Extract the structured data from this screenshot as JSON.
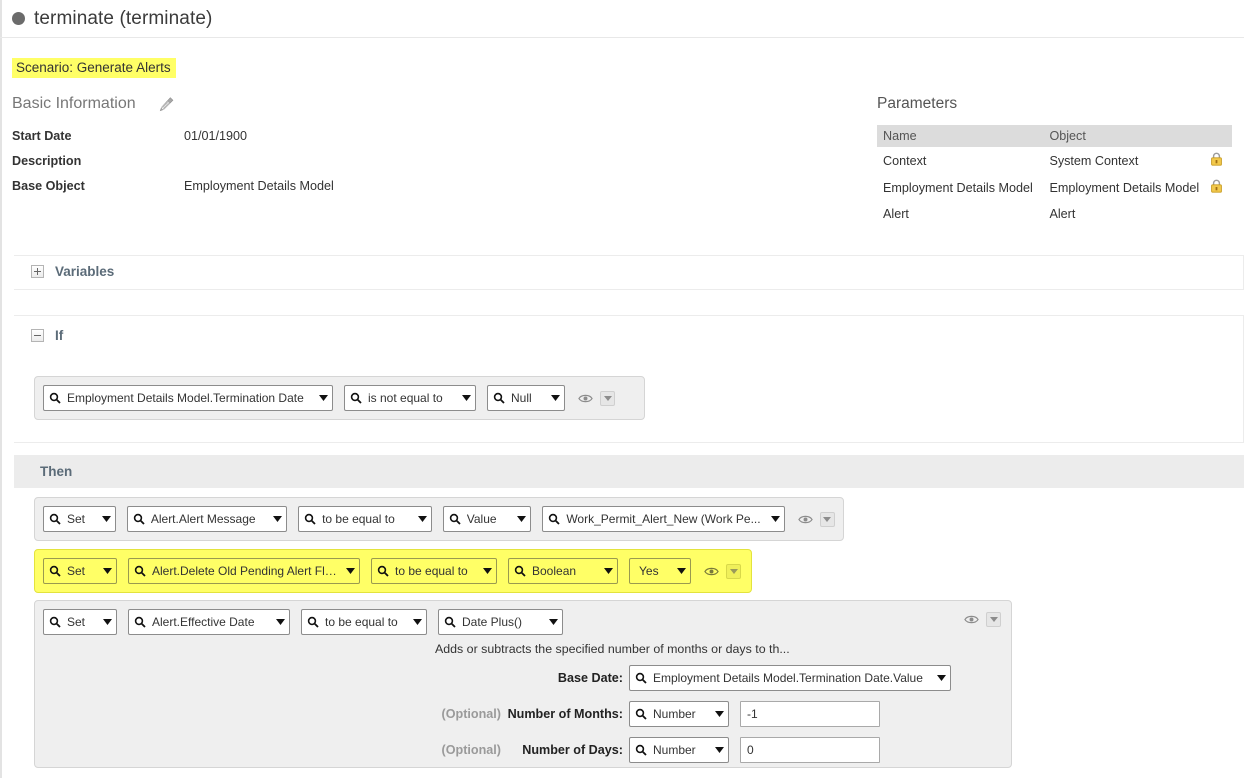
{
  "title": {
    "text": "terminate (terminate)",
    "status_icon": "circle-icon"
  },
  "scenario": {
    "label": "Scenario: Generate Alerts",
    "highlight_color": "#ffff66"
  },
  "basic_information": {
    "heading": "Basic Information",
    "edit_icon": "pencil-icon",
    "fields": [
      {
        "label": "Start Date",
        "value": "01/01/1900"
      },
      {
        "label": "Description",
        "value": ""
      },
      {
        "label": "Base Object",
        "value": "Employment Details Model"
      }
    ]
  },
  "parameters": {
    "heading": "Parameters",
    "columns": [
      "Name",
      "Object",
      ""
    ],
    "rows": [
      {
        "name": "Context",
        "object": "System Context",
        "locked": true
      },
      {
        "name": "Employment Details Model",
        "object": "Employment Details Model",
        "locked": true
      },
      {
        "name": "Alert",
        "object": "Alert",
        "locked": false
      }
    ]
  },
  "variables": {
    "title": "Variables",
    "expanded": false
  },
  "if_section": {
    "title": "If",
    "expanded": true,
    "condition": {
      "field": "Employment Details Model.Termination Date",
      "operator": "is not equal to",
      "value": "Null"
    }
  },
  "then_section": {
    "title": "Then",
    "statements": [
      {
        "action": "Set",
        "target": "Alert.Alert Message",
        "operator": "to be equal to",
        "type": "Value",
        "value": "Work_Permit_Alert_New (Work Pe...",
        "highlighted": false
      },
      {
        "action": "Set",
        "target": "Alert.Delete Old Pending Alert Flag",
        "operator": "to be equal to",
        "type": "Boolean",
        "value": "Yes",
        "highlighted": true
      },
      {
        "action": "Set",
        "target": "Alert.Effective Date",
        "operator": "to be equal to",
        "type": "Date Plus()",
        "highlighted": false,
        "function_detail": {
          "description": "Adds or subtracts the specified number of months or days to th...",
          "arguments": [
            {
              "optional_tag": "",
              "label": "Base Date:",
              "type": "Employment Details Model.Termination Date.Value",
              "input": null
            },
            {
              "optional_tag": "(Optional)",
              "label": "Number of Months:",
              "type": "Number",
              "input": "-1"
            },
            {
              "optional_tag": "(Optional)",
              "label": "Number of Days:",
              "type": "Number",
              "input": "0"
            }
          ]
        }
      }
    ]
  },
  "icons": {
    "search": "search-icon",
    "caret": "chevron-down-icon",
    "eye": "eye-icon",
    "lock": "lock-icon"
  }
}
